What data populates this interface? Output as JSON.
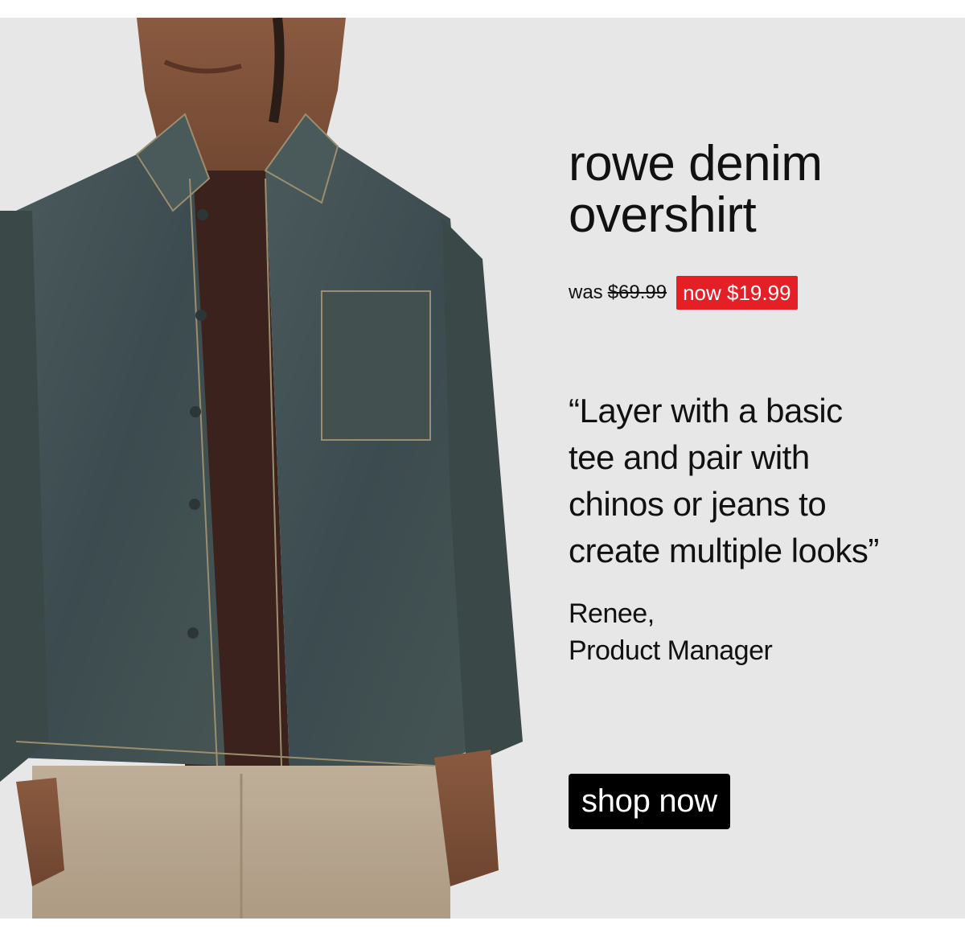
{
  "product": {
    "title_line_1": "rowe denim",
    "title_line_2": "overshirt",
    "image_alt": "model wearing rowe denim overshirt over a brown tee with beige chinos"
  },
  "pricing": {
    "was_label": "was",
    "was_price": "$69.99",
    "now_label": "now $19.99",
    "accent_color": "#e41f26"
  },
  "testimonial": {
    "quote_line_1": "“Layer with a basic",
    "quote_line_2": "tee and pair with",
    "quote_line_3": "chinos or jeans to",
    "quote_line_4": "create multiple looks”",
    "author_name": "Renee,",
    "author_role": "Product Manager"
  },
  "cta": {
    "label": "shop now"
  },
  "colors": {
    "background": "#e7e7e8",
    "text": "#111111",
    "button": "#000000"
  }
}
